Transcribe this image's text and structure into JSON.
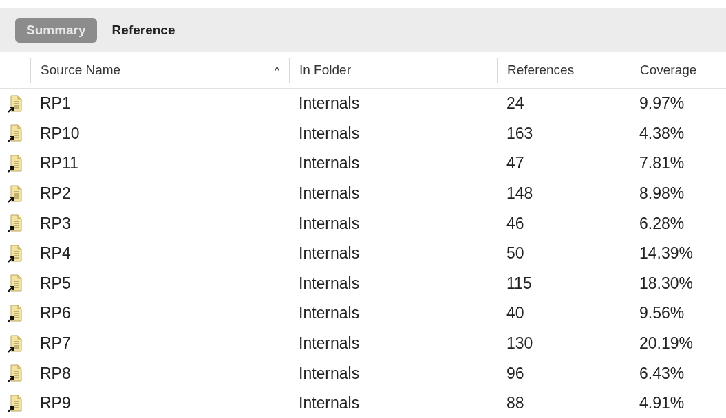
{
  "tabs": [
    {
      "label": "Summary",
      "selected": true
    },
    {
      "label": "Reference",
      "selected": false
    }
  ],
  "table": {
    "columns": [
      {
        "label": "Source Name",
        "sort_indicator": "^"
      },
      {
        "label": "In Folder"
      },
      {
        "label": "References"
      },
      {
        "label": "Coverage"
      }
    ],
    "rows": [
      {
        "name": "RP1",
        "folder": "Internals",
        "references": "24",
        "coverage": "9.97%"
      },
      {
        "name": "RP10",
        "folder": "Internals",
        "references": "163",
        "coverage": "4.38%"
      },
      {
        "name": "RP11",
        "folder": "Internals",
        "references": "47",
        "coverage": "7.81%"
      },
      {
        "name": "RP2",
        "folder": "Internals",
        "references": "148",
        "coverage": "8.98%"
      },
      {
        "name": "RP3",
        "folder": "Internals",
        "references": "46",
        "coverage": "6.28%"
      },
      {
        "name": "RP4",
        "folder": "Internals",
        "references": "50",
        "coverage": "14.39%"
      },
      {
        "name": "RP5",
        "folder": "Internals",
        "references": "115",
        "coverage": "18.30%"
      },
      {
        "name": "RP6",
        "folder": "Internals",
        "references": "40",
        "coverage": "9.56%"
      },
      {
        "name": "RP7",
        "folder": "Internals",
        "references": "130",
        "coverage": "20.19%"
      },
      {
        "name": "RP8",
        "folder": "Internals",
        "references": "96",
        "coverage": "6.43%"
      },
      {
        "name": "RP9",
        "folder": "Internals",
        "references": "88",
        "coverage": "4.91%"
      }
    ]
  }
}
